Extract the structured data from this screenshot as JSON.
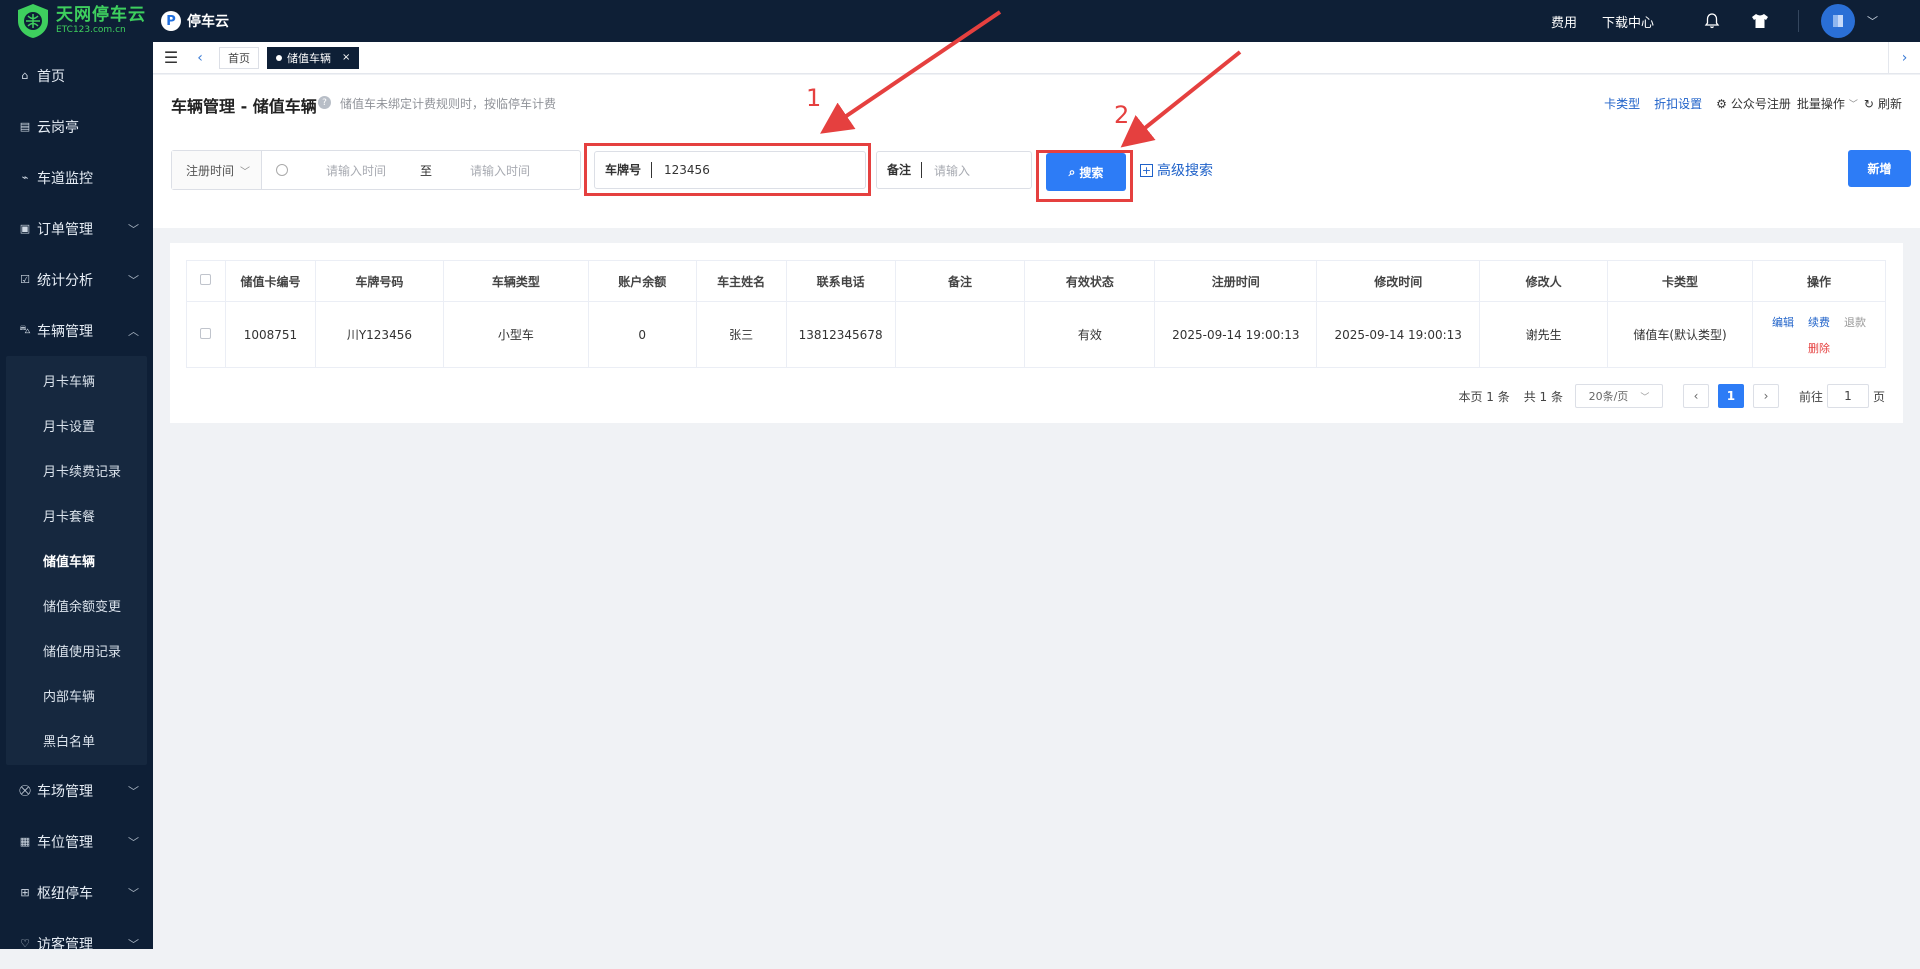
{
  "logo": {
    "name_cn": "天网停车云",
    "name_en": "ETC123.com.cn"
  },
  "brand": {
    "icon_letter": "P",
    "name": "停车云"
  },
  "top_nav": {
    "fee": "费用",
    "download": "下载中心",
    "bell_icon": "bell-icon",
    "shirt_icon": "tshirt-icon"
  },
  "sidebar": {
    "items": [
      {
        "label": "首页",
        "icon": "home-icon"
      },
      {
        "label": "云岗亭",
        "icon": "booth-icon"
      },
      {
        "label": "车道监控",
        "icon": "camera-icon"
      },
      {
        "label": "订单管理",
        "icon": "order-icon"
      },
      {
        "label": "统计分析",
        "icon": "chart-icon"
      },
      {
        "label": "车辆管理",
        "icon": "car-icon"
      }
    ],
    "submenu": [
      {
        "label": "月卡车辆"
      },
      {
        "label": "月卡设置"
      },
      {
        "label": "月卡续费记录"
      },
      {
        "label": "月卡套餐"
      },
      {
        "label": "储值车辆"
      },
      {
        "label": "储值余额变更"
      },
      {
        "label": "储值使用记录"
      },
      {
        "label": "内部车辆"
      },
      {
        "label": "黑白名单"
      }
    ],
    "items_after": [
      {
        "label": "车场管理",
        "icon": "parking-lot-icon"
      },
      {
        "label": "车位管理",
        "icon": "space-icon"
      },
      {
        "label": "枢纽停车",
        "icon": "hub-icon"
      },
      {
        "label": "访客管理",
        "icon": "visitor-icon"
      }
    ]
  },
  "tabs": {
    "home": "首页",
    "active": "储值车辆",
    "close": "×"
  },
  "page": {
    "title": "车辆管理 - 储值车辆",
    "hint": "储值车未绑定计费规则时，按临停车计费",
    "links": {
      "card_type": "卡类型",
      "discount": "折扣设置",
      "official": "公众号注册",
      "batch": "批量操作",
      "refresh": "刷新"
    }
  },
  "filters": {
    "date_select": "注册时间",
    "date_from_placeholder": "请输入时间",
    "date_sep": "至",
    "date_to_placeholder": "请输入时间",
    "plate_label": "车牌号",
    "plate_value": "123456",
    "remark_label": "备注",
    "remark_placeholder": "请输入",
    "search_label": "搜索",
    "advanced_label": "高级搜索",
    "add_label": "新增"
  },
  "annotations": {
    "one": "1",
    "two": "2"
  },
  "table": {
    "headers": [
      "储值卡编号",
      "车牌号码",
      "车辆类型",
      "账户余额",
      "车主姓名",
      "联系电话",
      "备注",
      "有效状态",
      "注册时间",
      "修改时间",
      "修改人",
      "卡类型",
      "操作"
    ],
    "rows": [
      {
        "card_no": "1008751",
        "plate": "川Y123456",
        "vehicle_type": "小型车",
        "balance": "0",
        "owner": "张三",
        "phone": "13812345678",
        "remark": "",
        "status": "有效",
        "reg_time": "2025-09-14 19:00:13",
        "mod_time": "2025-09-14 19:00:13",
        "modifier": "谢先生",
        "card_type": "储值车(默认类型)",
        "ops": {
          "edit": "编辑",
          "renew": "续费",
          "refund": "退款",
          "delete": "删除"
        }
      }
    ]
  },
  "pager": {
    "page_count": "本页 1 条",
    "total": "共 1 条",
    "page_size": "20条/页",
    "current": "1",
    "goto_label": "前往",
    "goto_value": "1",
    "goto_suffix": "页"
  },
  "colors": {
    "sidebar_bg": "#0e1f36",
    "primary": "#2d7cf6",
    "annotation_red": "#e5403f",
    "logo_green": "#3ecf5e"
  }
}
